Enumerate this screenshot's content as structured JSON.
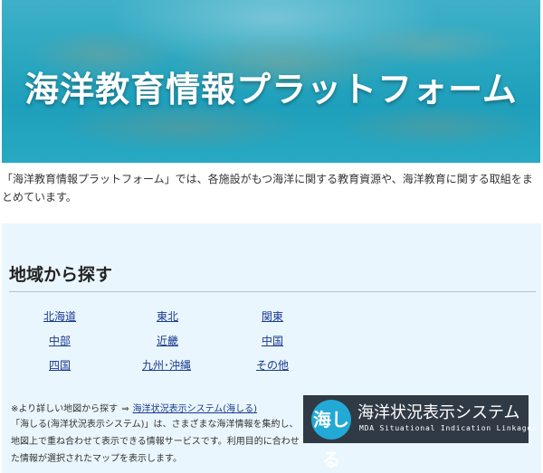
{
  "hero": {
    "title": "海洋教育情報プラットフォーム"
  },
  "intro": {
    "text": "「海洋教育情報プラットフォーム」では、各施設がもつ海洋に関する教育資源や、海洋教育に関する取組をまとめています。"
  },
  "regions": {
    "heading": "地域から探す",
    "links": [
      "北海道",
      "東北",
      "関東",
      "中部",
      "近畿",
      "中国",
      "四国",
      "九州･沖縄",
      "その他"
    ]
  },
  "map_note": {
    "prefix": "※より詳しい地図から探す",
    "arrow": "⇒",
    "link_label": "海洋状況表示システム(海しる)",
    "description": "「海しる(海洋状況表示システム)」は、さまざまな海洋情報を集約し、地図上で重ね合わせて表示できる情報サービスです。利用目的に合わせた情報が選択されたマップを表示します。"
  },
  "logo": {
    "mark_text": "海しる",
    "title_jp": "海洋状況表示システム",
    "subtitle_en": "MDA Situational Indication Linkages"
  }
}
